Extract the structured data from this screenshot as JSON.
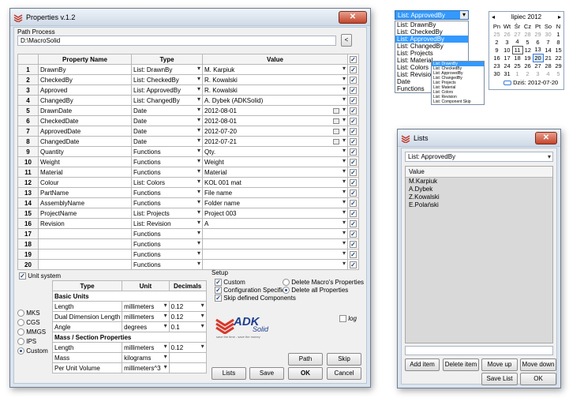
{
  "main": {
    "title": "Properties v.1.2",
    "path_label": "Path Process",
    "path_value": "D:\\MacroSolid",
    "back_btn": "<",
    "headers": {
      "name": "Property Name",
      "type": "Type",
      "value": "Value"
    },
    "rows": [
      {
        "n": "1",
        "name": "DrawnBy",
        "type": "List: DrawnBy",
        "value": "M. Karpiuk",
        "kind": "dd"
      },
      {
        "n": "2",
        "name": "CheckedBy",
        "type": "List: CheckedBy",
        "value": "R. Kowalski",
        "kind": "dd"
      },
      {
        "n": "3",
        "name": "Approved",
        "type": "List: ApprovedBy",
        "value": "R. Kowalski",
        "kind": "dd"
      },
      {
        "n": "4",
        "name": "ChangedBy",
        "type": "List: ChangedBy",
        "value": "A. Dybek (ADKSolid)",
        "kind": "dd"
      },
      {
        "n": "5",
        "name": "DrawnDate",
        "type": "Date",
        "value": "2012-08-01",
        "kind": "date"
      },
      {
        "n": "6",
        "name": "CheckedDate",
        "type": "Date",
        "value": "2012-08-01",
        "kind": "date"
      },
      {
        "n": "7",
        "name": "ApprovedDate",
        "type": "Date",
        "value": "2012-07-20",
        "kind": "date"
      },
      {
        "n": "8",
        "name": "ChangedDate",
        "type": "Date",
        "value": "2012-07-21",
        "kind": "date"
      },
      {
        "n": "9",
        "name": "Quantity",
        "type": "Functions",
        "value": "Qty.",
        "kind": "dd"
      },
      {
        "n": "10",
        "name": "Weight",
        "type": "Functions",
        "value": "Weight",
        "kind": "dd"
      },
      {
        "n": "11",
        "name": "Material",
        "type": "Functions",
        "value": "Material",
        "kind": "dd"
      },
      {
        "n": "12",
        "name": "Colour",
        "type": "List: Colors",
        "value": "KOL 001 mat",
        "kind": "dd"
      },
      {
        "n": "13",
        "name": "PartName",
        "type": "Functions",
        "value": "File name",
        "kind": "dd"
      },
      {
        "n": "14",
        "name": "AssemblyName",
        "type": "Functions",
        "value": "Folder name",
        "kind": "dd"
      },
      {
        "n": "15",
        "name": "ProjectName",
        "type": "List: Projects",
        "value": "Project 003",
        "kind": "dd"
      },
      {
        "n": "16",
        "name": "Revision",
        "type": "List: Revision",
        "value": "A",
        "kind": "dd"
      },
      {
        "n": "17",
        "name": "",
        "type": "Functions",
        "value": "",
        "kind": "dd"
      },
      {
        "n": "18",
        "name": "",
        "type": "Functions",
        "value": "",
        "kind": "dd"
      },
      {
        "n": "19",
        "name": "",
        "type": "Functions",
        "value": "",
        "kind": "dd"
      },
      {
        "n": "20",
        "name": "",
        "type": "Functions",
        "value": "",
        "kind": "dd"
      }
    ],
    "unit_system": "Unit system",
    "unit_headers": {
      "type": "Type",
      "unit": "Unit",
      "dec": "Decimals"
    },
    "basic_units": "Basic Units",
    "basic": [
      {
        "t": "Length",
        "u": "millimeters",
        "d": "0.12"
      },
      {
        "t": "Dual Dimension Length",
        "u": "millimeters",
        "d": "0.12"
      },
      {
        "t": "Angle",
        "u": "degrees",
        "d": "0.1"
      }
    ],
    "mass_units": "Mass / Section Properties",
    "mass": [
      {
        "t": "Length",
        "u": "millimeters",
        "d": "0.12"
      },
      {
        "t": "Mass",
        "u": "kilograms",
        "d": ""
      },
      {
        "t": "Per Unit Volume",
        "u": "millimeters^3",
        "d": ""
      }
    ],
    "systems": [
      "MKS",
      "CGS",
      "MMGS",
      "IPS",
      "Custom"
    ],
    "setup_label": "Setup",
    "setup_checks": [
      "Custom",
      "Configuration Specific",
      "Skip defined Components"
    ],
    "setup_radios": [
      "Delete Macro's Properties",
      "Delete all Properties"
    ],
    "log": "log",
    "logo_text": "ADK",
    "logo_sub": "Solid",
    "logo_tag": "save the time - save the money",
    "buttons": {
      "path": "Path",
      "skip": "Skip",
      "lists": "Lists",
      "save": "Save",
      "ok": "OK",
      "cancel": "Cancel"
    }
  },
  "dropdown": {
    "selected": "List: ApprovedBy",
    "items": [
      "List: DrawnBy",
      "List: CheckedBy",
      "List: ApprovedBy",
      "List: ChangedBy",
      "List: Projects",
      "List: Material",
      "List: Colors",
      "List: Revision",
      "Date",
      "Functions"
    ],
    "small_items": [
      "List: DrawnBy",
      "List: CheckedBy",
      "List: ApprovedBy",
      "List: ChangedBy",
      "List: Projects",
      "List: Material",
      "List: Colors",
      "List: Revision",
      "List: Component Skip"
    ]
  },
  "calendar": {
    "month": "lipiec 2012",
    "days": [
      "Pn",
      "Wt",
      "Śr",
      "Cz",
      "Pt",
      "So",
      "N"
    ],
    "weeks": [
      [
        "25",
        "26",
        "27",
        "28",
        "29",
        "30",
        "1"
      ],
      [
        "2",
        "3",
        "4",
        "5",
        "6",
        "7",
        "8"
      ],
      [
        "9",
        "10",
        "11",
        "12",
        "13",
        "14",
        "15"
      ],
      [
        "16",
        "17",
        "18",
        "19",
        "20",
        "21",
        "22"
      ],
      [
        "23",
        "24",
        "25",
        "26",
        "27",
        "28",
        "29"
      ],
      [
        "30",
        "31",
        "1",
        "2",
        "3",
        "4",
        "5"
      ]
    ],
    "today": "Dziś: 2012-07-20"
  },
  "lists": {
    "title": "Lists",
    "selected": "List: ApprovedBy",
    "value_header": "Value",
    "values": [
      "M.Karpiuk",
      "A.Dybek",
      "Z.Kowalski",
      "E.Polański"
    ],
    "buttons": {
      "add": "Add item",
      "del": "Delete item",
      "up": "Move up",
      "down": "Move down",
      "save": "Save List",
      "ok": "OK"
    }
  }
}
